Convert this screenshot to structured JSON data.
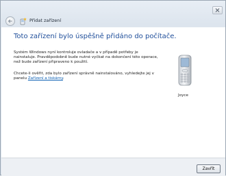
{
  "window": {
    "title": "Přidat zařízení"
  },
  "content": {
    "heading": "Toto zařízení bylo úspěšně přidáno do počítače.",
    "paragraph1": "Systém Windows nyní kontroluje ovladače a v případě potřeby je nainstaluje. Pravděpodobně bude nutné vyčkat na dokončení této operace, než bude zařízení připraveno k použití.",
    "paragraph2_before_link": "Chcete-li ověřit, zda bylo zařízení správně nainstalováno, vyhledejte jej v panelu ",
    "paragraph2_link": "Zařízení a tiskárny",
    "paragraph2_after_link": "."
  },
  "device": {
    "name": "Joyce",
    "icon": "mobile-phone-icon"
  },
  "footer": {
    "finish_label": "Zavřít"
  },
  "icons": {
    "close": "close-icon",
    "back": "back-arrow-icon",
    "wizard": "add-device-icon"
  }
}
